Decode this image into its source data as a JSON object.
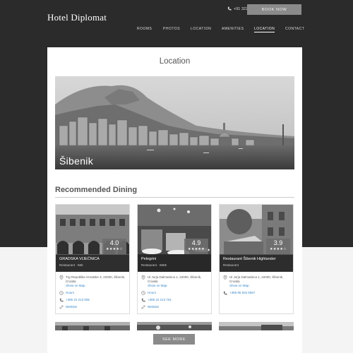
{
  "header": {
    "brand": "Hotel Diplomat",
    "phone": "+91 322557140",
    "book_label": "BOOK NOW"
  },
  "nav": {
    "items": [
      {
        "label": "ROOMS"
      },
      {
        "label": "PHOTOS"
      },
      {
        "label": "LOCATION"
      },
      {
        "label": "AMENITIES"
      },
      {
        "label": "LOCATION",
        "active": true
      },
      {
        "label": "CONTACT"
      }
    ]
  },
  "main": {
    "title": "Location",
    "hero_caption": "Šibenik",
    "dining_title": "Recommended Dining",
    "see_more_label": "SEE MORE"
  },
  "restaurants": [
    {
      "name": "GRADSKA VIJEĆNICA",
      "meta": "Restaurant · €€€",
      "rating": "4.0",
      "stars": "★★★★☆",
      "address": "Trg Republike Hrvatske 3, 22000, Šibenik, Croatia",
      "map_label": "Show on Map",
      "hours_label": "Hours",
      "phone": "+385 22 213 605",
      "website_label": "Website"
    },
    {
      "name": "Pelegrini",
      "meta": "Restaurant · €€€€",
      "rating": "4.9",
      "stars": "★★★★★",
      "address": "Ul Jurja Dalmatinca 1, 22000, Šibenik, Croatia",
      "map_label": "Show on Map",
      "hours_label": "Hours",
      "phone": "+385 22 213 701",
      "website_label": "Website"
    },
    {
      "name": "Restaurant Šibenik Highlander",
      "meta": "Restaurant",
      "rating": "3.9",
      "stars": "★★★★☆",
      "address": "Ul Jurja Dalmatinca 1, 22000, Šibenik, Croatia",
      "map_label": "Show on Map",
      "phone": "+385 95 834 5567"
    }
  ]
}
